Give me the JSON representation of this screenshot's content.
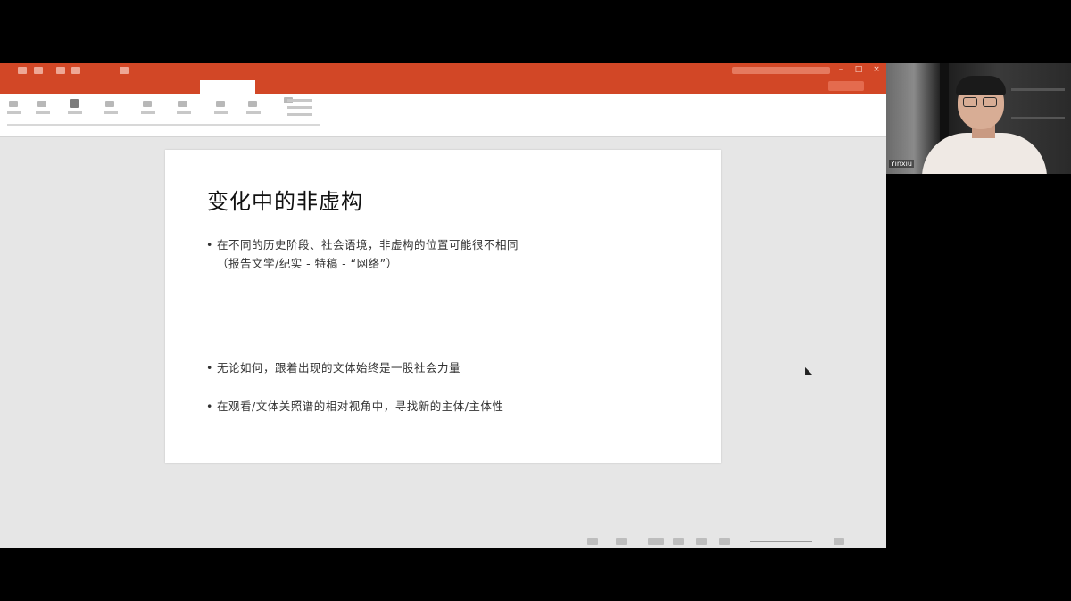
{
  "app": {
    "document_title": "",
    "ribbon_tabs": [
      "",
      "",
      "",
      "",
      "",
      "",
      "",
      "",
      ""
    ]
  },
  "slide": {
    "title": "变化中的非虚构",
    "bullets": [
      {
        "text": "在不同的历史阶段、社会语境，非虚构的位置可能很不相同",
        "continuation": "（报告文学/纪实 - 特稿 - “网络”）"
      },
      {
        "text": "无论如何，跟着出现的文体始终是一股社会力量",
        "continuation": ""
      },
      {
        "text": "在观看/文体关照谱的相对视角中，寻找新的主体/主体性",
        "continuation": ""
      }
    ],
    "bullet_char": "•"
  },
  "notes": {
    "placeholder": ""
  },
  "status": {
    "slide_info": ""
  },
  "webcam": {
    "participant_name": "Yinxiu"
  },
  "colors": {
    "title_bar": "#d24726",
    "ribbon_bg": "#ffffff",
    "workspace_bg": "#e6e6e6",
    "slide_bg": "#ffffff"
  },
  "icons": {
    "cursor": "mouse-pointer-icon",
    "minimize": "minimize-icon",
    "maximize": "maximize-icon",
    "close": "close-icon"
  }
}
